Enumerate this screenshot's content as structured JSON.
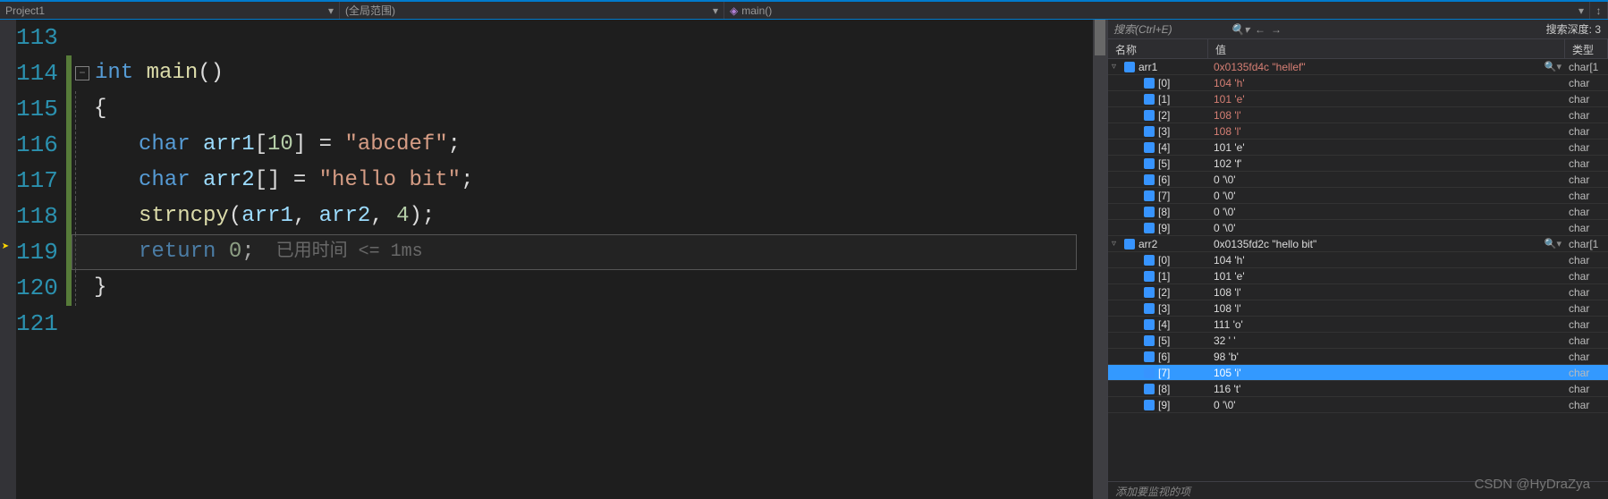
{
  "top": {
    "project": "Project1",
    "scope": "(全局范围)",
    "context_icon": "◈",
    "context": "main()"
  },
  "editor": {
    "lines": [
      113,
      114,
      115,
      116,
      117,
      118,
      119,
      120,
      121
    ],
    "current_line": 119,
    "elapsed_hint": "已用时间 <= 1ms",
    "code": {
      "l114_kw": "int ",
      "l114_fn": "main",
      "l114_par": "()",
      "l115": "{",
      "l116_kw": "char ",
      "l116_id": "arr1",
      "l116_br": "[",
      "l116_n": "10",
      "l116_br2": "] = ",
      "l116_s": "\"abcdef\"",
      "l116_e": ";",
      "l117_kw": "char ",
      "l117_id": "arr2",
      "l117_br": "[] = ",
      "l117_s": "\"hello bit\"",
      "l117_e": ";",
      "l118_fn": "strncpy",
      "l118_p": "(",
      "l118_a1": "arr1",
      "l118_c1": ", ",
      "l118_a2": "arr2",
      "l118_c2": ", ",
      "l118_n": "4",
      "l118_e": ");",
      "l119_kw": "return ",
      "l119_n": "0",
      "l119_e": ";",
      "l120": "}"
    }
  },
  "watch": {
    "search_placeholder": "搜索(Ctrl+E)",
    "depth_label": "搜索深度:",
    "depth_value": "3",
    "head_name": "名称",
    "head_value": "值",
    "head_type": "类型",
    "footer": "添加要监视的项",
    "rows": [
      {
        "d": 0,
        "exp": "▿",
        "name": "arr1",
        "value": "0x0135fd4c \"hellef\"",
        "changed": true,
        "mag": true,
        "type": "char[1"
      },
      {
        "d": 1,
        "name": "[0]",
        "value": "104 'h'",
        "changed": true,
        "type": "char"
      },
      {
        "d": 1,
        "name": "[1]",
        "value": "101 'e'",
        "changed": true,
        "type": "char"
      },
      {
        "d": 1,
        "name": "[2]",
        "value": "108 'l'",
        "changed": true,
        "type": "char"
      },
      {
        "d": 1,
        "name": "[3]",
        "value": "108 'l'",
        "changed": true,
        "type": "char"
      },
      {
        "d": 1,
        "name": "[4]",
        "value": "101 'e'",
        "type": "char"
      },
      {
        "d": 1,
        "name": "[5]",
        "value": "102 'f'",
        "type": "char"
      },
      {
        "d": 1,
        "name": "[6]",
        "value": "0 '\\0'",
        "type": "char"
      },
      {
        "d": 1,
        "name": "[7]",
        "value": "0 '\\0'",
        "type": "char"
      },
      {
        "d": 1,
        "name": "[8]",
        "value": "0 '\\0'",
        "type": "char"
      },
      {
        "d": 1,
        "name": "[9]",
        "value": "0 '\\0'",
        "type": "char"
      },
      {
        "d": 0,
        "exp": "▿",
        "name": "arr2",
        "value": "0x0135fd2c \"hello bit\"",
        "mag": true,
        "type": "char[1"
      },
      {
        "d": 1,
        "name": "[0]",
        "value": "104 'h'",
        "type": "char"
      },
      {
        "d": 1,
        "name": "[1]",
        "value": "101 'e'",
        "type": "char"
      },
      {
        "d": 1,
        "name": "[2]",
        "value": "108 'l'",
        "type": "char"
      },
      {
        "d": 1,
        "name": "[3]",
        "value": "108 'l'",
        "type": "char"
      },
      {
        "d": 1,
        "name": "[4]",
        "value": "111 'o'",
        "type": "char"
      },
      {
        "d": 1,
        "name": "[5]",
        "value": "32 ' '",
        "type": "char"
      },
      {
        "d": 1,
        "name": "[6]",
        "value": "98 'b'",
        "type": "char"
      },
      {
        "d": 1,
        "name": "[7]",
        "value": "105 'i'",
        "type": "char",
        "sel": true
      },
      {
        "d": 1,
        "name": "[8]",
        "value": "116 't'",
        "type": "char"
      },
      {
        "d": 1,
        "name": "[9]",
        "value": "0 '\\0'",
        "type": "char"
      }
    ]
  },
  "watermark": "CSDN @HyDraZya"
}
